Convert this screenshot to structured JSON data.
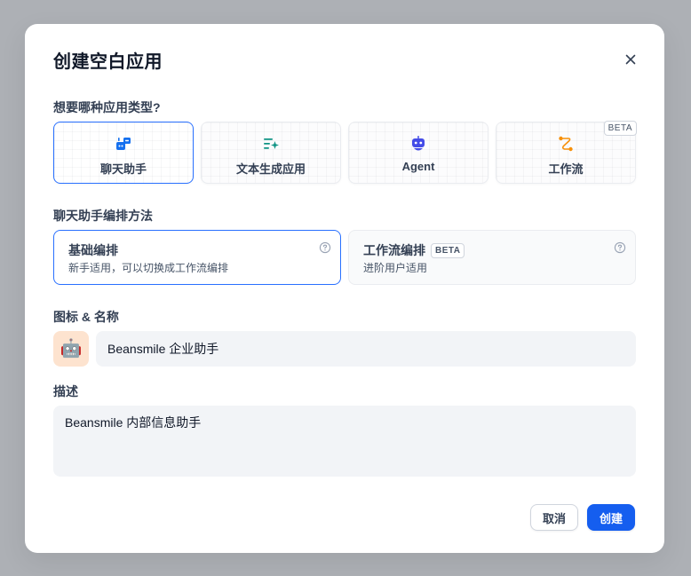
{
  "modal": {
    "title": "创建空白应用",
    "close_icon": "close-icon"
  },
  "app_type": {
    "label": "想要哪种应用类型?",
    "options": [
      {
        "label": "聊天助手",
        "icon": "chat-bot-icon",
        "selected": true,
        "color": "#1570ef"
      },
      {
        "label": "文本生成应用",
        "icon": "text-generation-icon",
        "selected": false,
        "color": "#0e9384"
      },
      {
        "label": "Agent",
        "icon": "agent-robot-icon",
        "selected": false,
        "color": "#444ce7"
      },
      {
        "label": "工作流",
        "icon": "workflow-icon",
        "selected": false,
        "badge": "BETA",
        "color": "#f79009"
      }
    ]
  },
  "orchestration": {
    "label": "聊天助手编排方法",
    "options": [
      {
        "title": "基础编排",
        "description": "新手适用，可以切换成工作流编排",
        "selected": true
      },
      {
        "title": "工作流编排",
        "badge": "BETA",
        "description": "进阶用户适用",
        "selected": false
      }
    ]
  },
  "name": {
    "label": "图标 & 名称",
    "icon": "robot-emoji",
    "icon_glyph": "🤖",
    "icon_background": "#fde3cf",
    "value": "Beansmile 企业助手"
  },
  "description": {
    "label": "描述",
    "value": "Beansmile 内部信息助手"
  },
  "footer": {
    "cancel_label": "取消",
    "create_label": "创建"
  },
  "colors": {
    "accent": "#155eef",
    "selected_border": "#2970ff",
    "input_background": "#f2f4f7",
    "overlay": "#adb0b5"
  }
}
